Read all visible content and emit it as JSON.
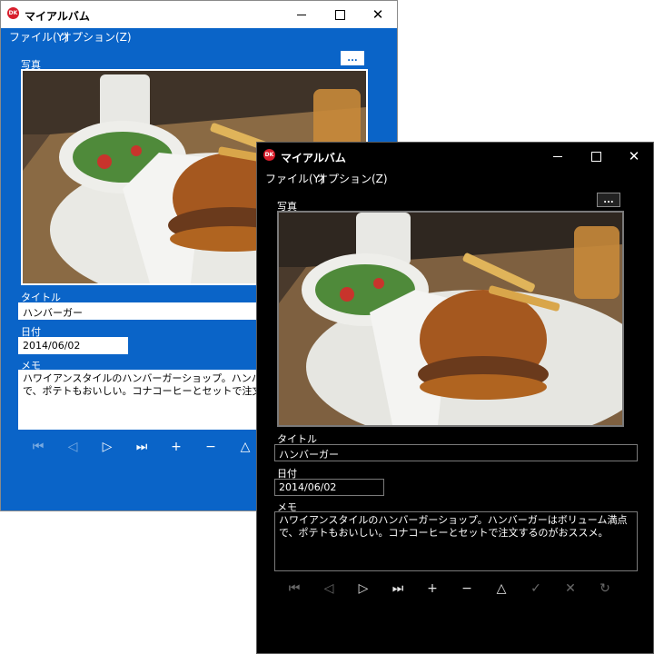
{
  "app": {
    "title": "マイアルバム",
    "icon_text": "DK"
  },
  "menu": {
    "file": "ファイル(Y)",
    "options": "オプション(Z)"
  },
  "form": {
    "photo_label": "写真",
    "browse_label": "...",
    "title_label": "タイトル",
    "title_value": "ハンバーガー",
    "date_label": "日付",
    "date_value": "2014/06/02",
    "memo_label": "メモ",
    "memo_value": "ハワイアンスタイルのハンバーガーショップ。ハンバーガーはボリューム満点で、ポテトもおいしい。コナコーヒーとセットで注文するのがおススメ。"
  },
  "toolbar": {
    "first": "⏮",
    "prev": "◁",
    "next": "▷",
    "last": "⏭",
    "add": "+",
    "remove": "−",
    "up": "△",
    "ok": "✓",
    "cancel": "✕",
    "refresh": "↻"
  },
  "colors": {
    "blue_window_bg": "#0a64c8",
    "dark_window_bg": "#000000",
    "accent_icon": "#d81e2c"
  }
}
